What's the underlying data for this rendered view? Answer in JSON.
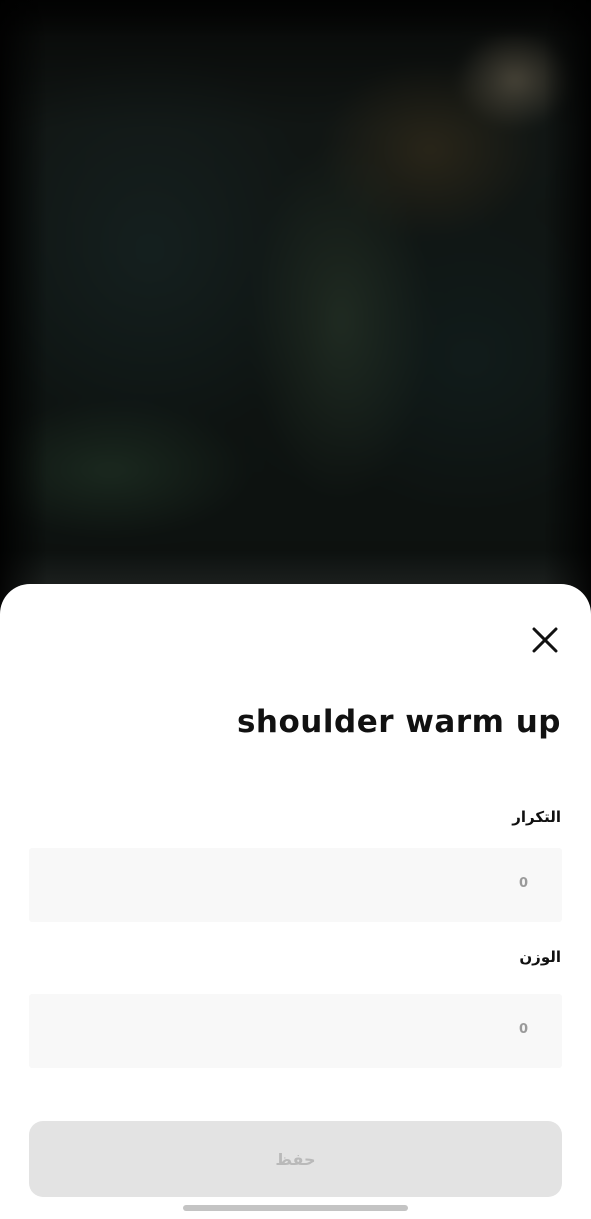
{
  "sheet": {
    "title": "shoulder warm up",
    "close_icon": "close-icon",
    "fields": {
      "reps": {
        "label": "التكرار",
        "value": "0"
      },
      "weight": {
        "label": "الوزن",
        "value": "0"
      }
    },
    "save_button": {
      "label": "حفظ",
      "disabled": true
    }
  },
  "colors": {
    "sheet_background": "#ffffff",
    "field_background": "#f8f8f8",
    "button_disabled_background": "#e3e3e3",
    "button_disabled_text": "#b9b9b9",
    "title_text": "#111111"
  }
}
